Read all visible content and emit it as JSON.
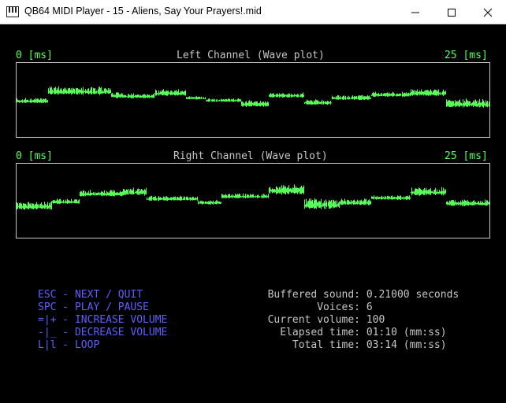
{
  "window": {
    "title": "QB64 MIDI Player - 15 - Aliens, Say Your Prayers!.mid",
    "icon": "piano-keys-icon",
    "controls": [
      "minimize-icon",
      "maximize-icon",
      "close-icon"
    ]
  },
  "left_plot": {
    "title": "Left Channel (Wave plot)",
    "start_label": "0 [ms]",
    "end_label": "25 [ms]"
  },
  "right_plot": {
    "title": "Right Channel (Wave plot)",
    "start_label": "0 [ms]",
    "end_label": "25 [ms]"
  },
  "keys": [
    "ESC - NEXT / QUIT",
    "SPC - PLAY / PAUSE",
    "=|+ - INCREASE VOLUME",
    "-|_ - DECREASE VOLUME",
    "L|l - LOOP"
  ],
  "stats": [
    {
      "label": "Buffered sound:",
      "value": "0.21000 seconds"
    },
    {
      "label": "Voices:",
      "value": "6"
    },
    {
      "label": "Current volume:",
      "value": "100"
    },
    {
      "label": "Elapsed time:",
      "value": "01:10 (mm:ss)"
    },
    {
      "label": "Total time:",
      "value": "03:14 (mm:ss)"
    }
  ],
  "colors": {
    "wave": "#55ff55",
    "accent_text": "#55ff55",
    "key_text": "#5f5fff",
    "plain_text": "#c6c6c6",
    "background": "#000000"
  }
}
